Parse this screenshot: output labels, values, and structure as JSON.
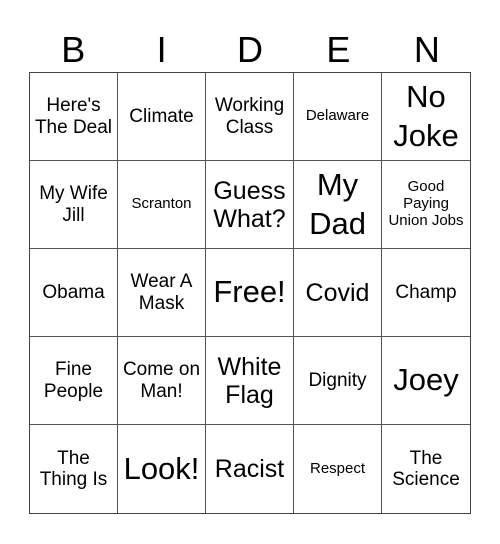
{
  "title_letters": [
    "B",
    "I",
    "D",
    "E",
    "N"
  ],
  "cells": [
    {
      "text": "Here's The Deal",
      "size": "md"
    },
    {
      "text": "Climate",
      "size": "md"
    },
    {
      "text": "Working Class",
      "size": "md"
    },
    {
      "text": "Delaware",
      "size": "sm"
    },
    {
      "text": "No Joke",
      "size": "xl"
    },
    {
      "text": "My Wife Jill",
      "size": "md"
    },
    {
      "text": "Scranton",
      "size": "sm"
    },
    {
      "text": "Guess What?",
      "size": "lg"
    },
    {
      "text": "My Dad",
      "size": "xl"
    },
    {
      "text": "Good Paying Union Jobs",
      "size": "sm"
    },
    {
      "text": "Obama",
      "size": "md"
    },
    {
      "text": "Wear A Mask",
      "size": "md"
    },
    {
      "text": "Free!",
      "size": "xl"
    },
    {
      "text": "Covid",
      "size": "lg"
    },
    {
      "text": "Champ",
      "size": "md"
    },
    {
      "text": "Fine People",
      "size": "md"
    },
    {
      "text": "Come on Man!",
      "size": "md"
    },
    {
      "text": "White Flag",
      "size": "lg"
    },
    {
      "text": "Dignity",
      "size": "md"
    },
    {
      "text": "Joey",
      "size": "xl"
    },
    {
      "text": "The Thing Is",
      "size": "md"
    },
    {
      "text": "Look!",
      "size": "xl"
    },
    {
      "text": "Racist",
      "size": "lg"
    },
    {
      "text": "Respect",
      "size": "sm"
    },
    {
      "text": "The Science",
      "size": "md"
    }
  ]
}
